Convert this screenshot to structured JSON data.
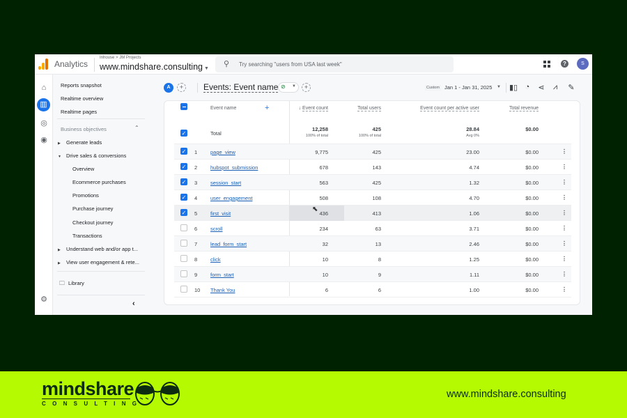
{
  "colors": {
    "page_bg": "#002200",
    "band": "#b5fa00",
    "brand_dark": "#0d2b10",
    "accent": "#1a73e8",
    "link": "#1a5fb4",
    "success": "#188038"
  },
  "topbar": {
    "app_name": "Analytics",
    "breadcrumb": "Inhouse > JM Projects",
    "property": "www.mindshare.consulting",
    "search_placeholder": "Try searching \"users from USA last week\"",
    "avatar_initial": "S"
  },
  "rail": {
    "icons": [
      "home-icon",
      "reports-icon",
      "explore-icon",
      "advertising-icon"
    ],
    "active": "reports-icon",
    "settings": "settings-icon"
  },
  "nav": {
    "top_items": [
      "Reports snapshot",
      "Realtime overview",
      "Realtime pages"
    ],
    "section_heading": "Business objectives",
    "groups": [
      {
        "label": "Generate leads",
        "expanded": false
      },
      {
        "label": "Drive sales & conversions",
        "expanded": true,
        "children": [
          "Overview",
          "Ecommerce purchases",
          "Promotions",
          "Purchase journey",
          "Checkout journey",
          "Transactions"
        ]
      },
      {
        "label": "Understand web and/or app t...",
        "expanded": false
      },
      {
        "label": "View user engagement & rete...",
        "expanded": false
      }
    ],
    "library": "Library",
    "collapse": "‹"
  },
  "toolbar": {
    "comparison_chip": "A",
    "report_title": "Events: Event name",
    "date_tag": "Custom",
    "date_range": "Jan 1 - Jan 31, 2025"
  },
  "table": {
    "columns": [
      "Event name",
      "Event count",
      "Total users",
      "Event count per active user",
      "Total revenue"
    ],
    "sort_column": "Event count",
    "sort_direction": "desc",
    "total": {
      "label": "Total",
      "event_count": "12,258",
      "event_count_sub": "100% of total",
      "total_users": "425",
      "total_users_sub": "100% of total",
      "per_user": "28.84",
      "per_user_sub": "Avg 0%",
      "revenue": "$0.00"
    },
    "rows": [
      {
        "rank": "1",
        "name": "page_view",
        "count": "9,775",
        "users": "425",
        "per_user": "23.00",
        "revenue": "$0.00",
        "checked": true
      },
      {
        "rank": "2",
        "name": "hubspot_submission",
        "count": "678",
        "users": "143",
        "per_user": "4.74",
        "revenue": "$0.00",
        "checked": true
      },
      {
        "rank": "3",
        "name": "session_start",
        "count": "563",
        "users": "425",
        "per_user": "1.32",
        "revenue": "$0.00",
        "checked": true
      },
      {
        "rank": "4",
        "name": "user_engagement",
        "count": "508",
        "users": "108",
        "per_user": "4.70",
        "revenue": "$0.00",
        "checked": true
      },
      {
        "rank": "5",
        "name": "first_visit",
        "count": "436",
        "users": "413",
        "per_user": "1.06",
        "revenue": "$0.00",
        "checked": true
      },
      {
        "rank": "6",
        "name": "scroll",
        "count": "234",
        "users": "63",
        "per_user": "3.71",
        "revenue": "$0.00",
        "checked": false
      },
      {
        "rank": "7",
        "name": "lead_form_start",
        "count": "32",
        "users": "13",
        "per_user": "2.46",
        "revenue": "$0.00",
        "checked": false
      },
      {
        "rank": "8",
        "name": "click",
        "count": "10",
        "users": "8",
        "per_user": "1.25",
        "revenue": "$0.00",
        "checked": false
      },
      {
        "rank": "9",
        "name": "form_start",
        "count": "10",
        "users": "9",
        "per_user": "1.11",
        "revenue": "$0.00",
        "checked": false
      },
      {
        "rank": "10",
        "name": "Thank You",
        "count": "6",
        "users": "6",
        "per_user": "1.00",
        "revenue": "$0.00",
        "checked": false
      }
    ]
  },
  "footer": {
    "brand": "mindshare",
    "brand_sub": "CONSULTING",
    "url": "www.mindshare.consulting"
  }
}
